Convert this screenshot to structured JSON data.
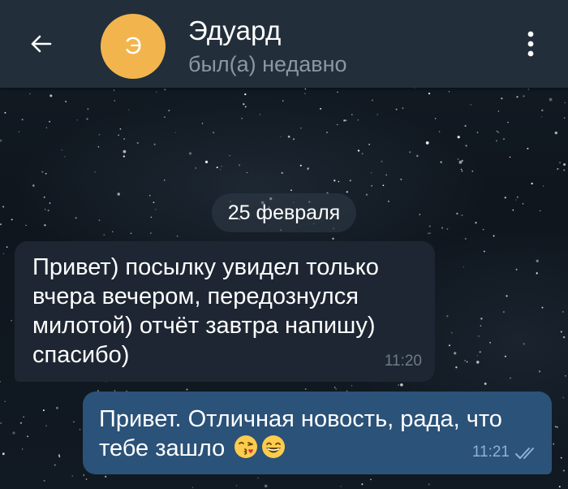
{
  "header": {
    "avatar_letter": "Э",
    "name": "Эдуард",
    "status": "был(а) недавно",
    "back_icon": "arrow-left-icon",
    "menu_icon": "more-vertical-icon"
  },
  "chat": {
    "date_label": "25 февраля",
    "messages": [
      {
        "direction": "incoming",
        "text": "Привет) посылку увидел только\nвчера вечером, передознулся\nмилотой) отчёт завтра напишу)\nспасибо)",
        "time": "11:20"
      },
      {
        "direction": "outgoing",
        "text": "Привет. Отличная новость, рада, что\nтебе зашло",
        "emojis": [
          "kissing-face-emoji",
          "grinning-face-emoji"
        ],
        "time": "11:21",
        "status_icon": "double-check-icon"
      }
    ]
  },
  "colors": {
    "appbar": "#222e3a",
    "avatar": "#f2b54e",
    "incoming_bubble": "#1d2632",
    "outgoing_bubble": "#2b5278",
    "status_text": "#8a98a6"
  }
}
